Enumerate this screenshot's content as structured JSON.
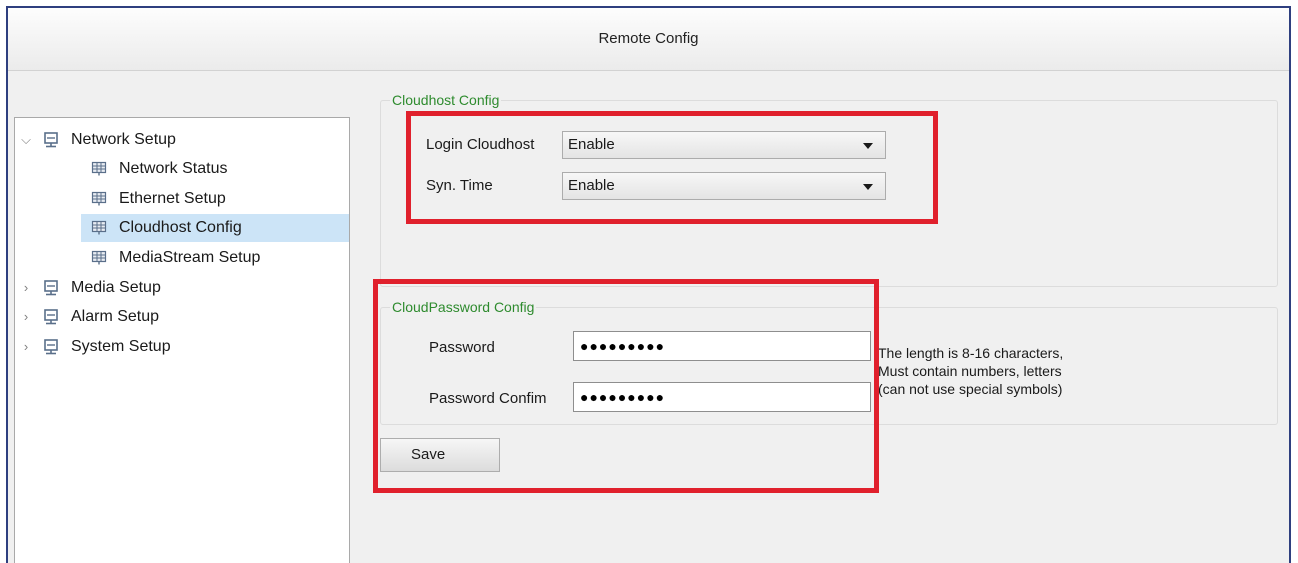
{
  "window": {
    "title": "Remote Config"
  },
  "tree": {
    "items": [
      {
        "label": "Network Setup",
        "level": 0,
        "expanded": true,
        "icon": "network-folder-icon"
      },
      {
        "label": "Network Status",
        "level": 1,
        "icon": "grid-page-icon"
      },
      {
        "label": "Ethernet Setup",
        "level": 1,
        "icon": "grid-page-icon"
      },
      {
        "label": "Cloudhost Config",
        "level": 1,
        "selected": true,
        "icon": "grid-page-icon"
      },
      {
        "label": "MediaStream Setup",
        "level": 1,
        "icon": "grid-page-icon"
      },
      {
        "label": "Media Setup",
        "level": 0,
        "expanded": false,
        "icon": "network-folder-icon"
      },
      {
        "label": "Alarm Setup",
        "level": 0,
        "expanded": false,
        "icon": "network-folder-icon"
      },
      {
        "label": "System Setup",
        "level": 0,
        "expanded": false,
        "icon": "network-folder-icon"
      }
    ]
  },
  "cloudhost": {
    "title": "Cloudhost Config",
    "login_label": "Login Cloudhost",
    "login_value": "Enable",
    "syn_label": "Syn. Time",
    "syn_value": "Enable"
  },
  "cloudpassword": {
    "title": "CloudPassword Config",
    "password_label": "Password",
    "password_value": "●●●●●●●●●",
    "confirm_label": "Password Confim",
    "confirm_value": "●●●●●●●●●",
    "hint_line1": "The length is 8-16 characters,",
    "hint_line2": "Must contain numbers, letters",
    "hint_line3": "(can not use special symbols)"
  },
  "actions": {
    "save_label": "Save"
  },
  "colors": {
    "highlight_border": "#e0202c",
    "group_title": "#2e8b2e",
    "selection": "#cce4f7"
  }
}
